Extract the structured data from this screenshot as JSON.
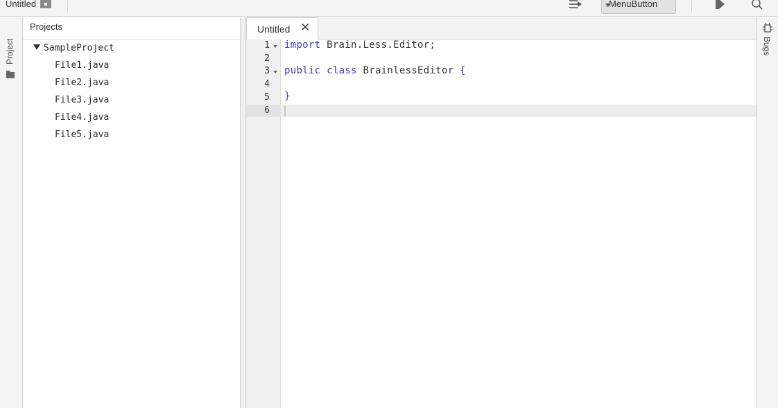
{
  "toolbar": {
    "title": "Untitled",
    "menu_button_label": "MenuButton",
    "icons": [
      "save-icon",
      "wrap-icon",
      "run-icon",
      "search-icon"
    ]
  },
  "left_strip": {
    "project_label": "Project"
  },
  "projects_panel": {
    "header": "Projects",
    "root": "SampleProject",
    "files": [
      "File1.java",
      "File2.java",
      "File3.java",
      "File4.java",
      "File5.java"
    ]
  },
  "editor": {
    "tab_label": "Untitled",
    "tab_close": "✕",
    "line_numbers": [
      "1",
      "2",
      "3",
      "4",
      "5",
      "6"
    ],
    "lines": {
      "l1_kw": "import",
      "l1_rest": " Brain.Less.Editor;",
      "l3_kw1": "public",
      "l3_kw2": "class",
      "l3_name": " BrainlessEditor ",
      "l3_brace": "{",
      "l5_brace": "}"
    }
  },
  "right_strip": {
    "bugs_label": "Bugs"
  }
}
